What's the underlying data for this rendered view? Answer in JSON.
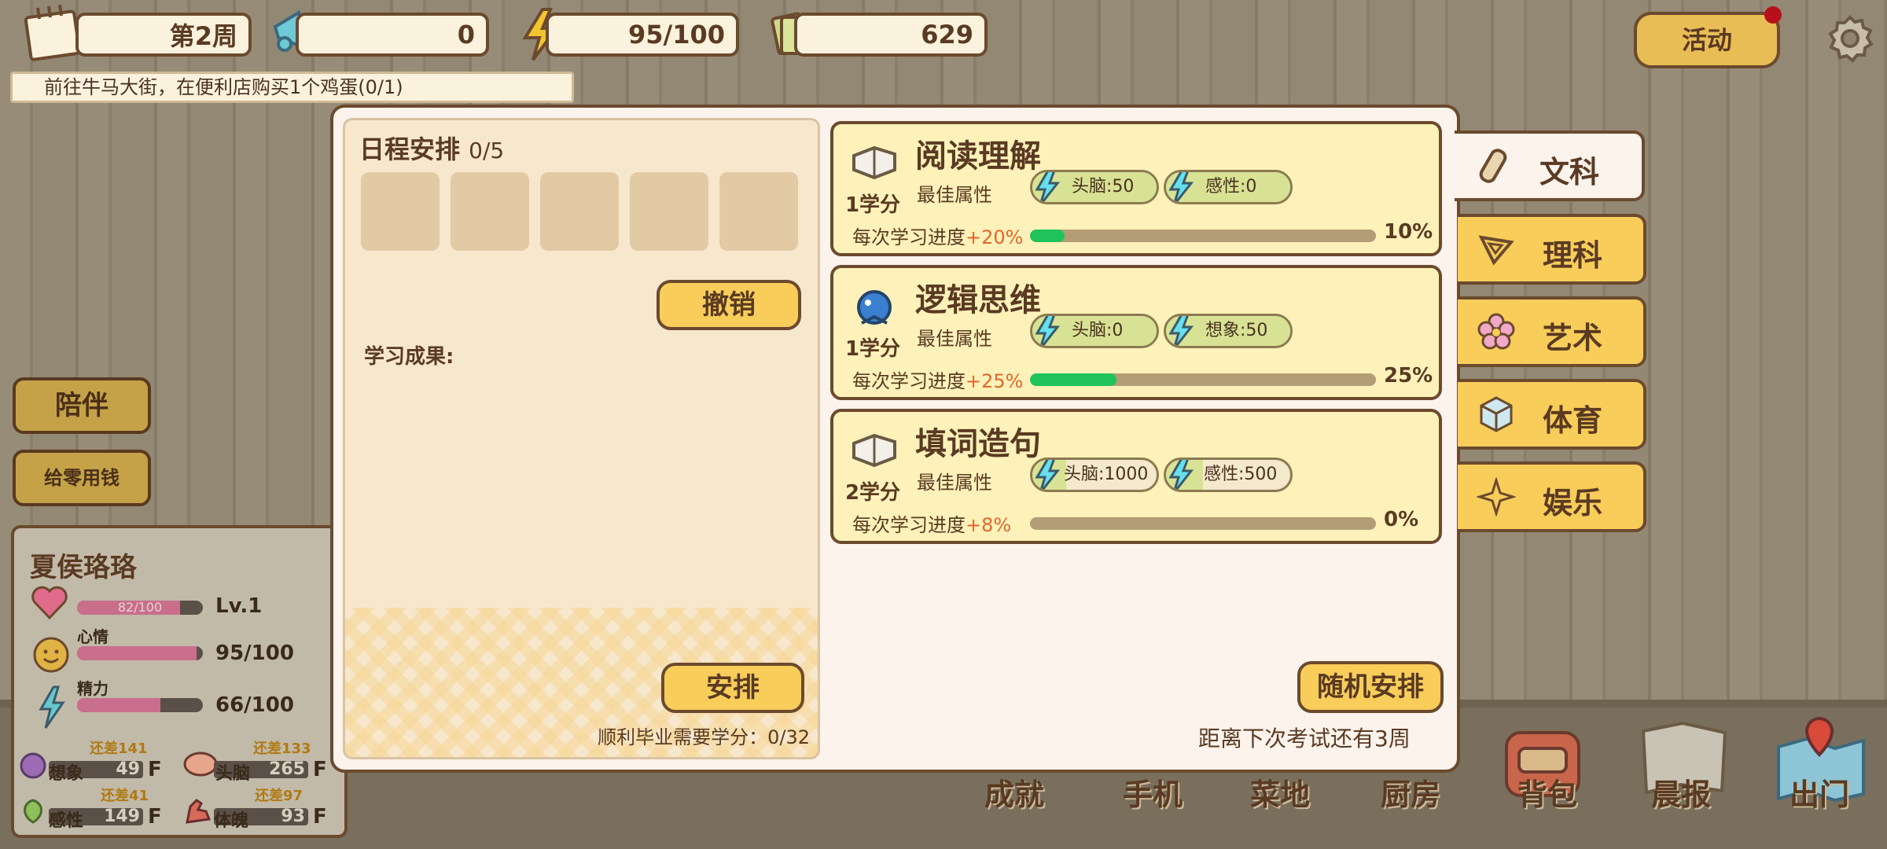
{
  "hud": {
    "week": "第2周",
    "fans": "0",
    "energy": "95/100",
    "money": "629",
    "event_button": "活动"
  },
  "task": "前往牛马大街，在便利店购买1个鸡蛋(0/1)",
  "side_buttons": {
    "accompany": "陪伴",
    "pocket_money": "给零用钱"
  },
  "character": {
    "name": "夏侯珞珞",
    "health_text": "82/100",
    "health_fraction": 0.82,
    "level": "Lv.1",
    "mood_label": "心情",
    "mood_value": "95/100",
    "mood_fraction": 0.95,
    "stamina_label": "精力",
    "stamina_value": "66/100",
    "stamina_fraction": 0.66,
    "attributes": [
      {
        "name": "想象",
        "value": "49",
        "grade": "F",
        "short": "还差141"
      },
      {
        "name": "头脑",
        "value": "265",
        "grade": "F",
        "short": "还差133"
      },
      {
        "name": "感性",
        "value": "149",
        "grade": "F",
        "short": "还差41"
      },
      {
        "name": "体魄",
        "value": "93",
        "grade": "F",
        "short": "还差97"
      }
    ]
  },
  "bottom_nav": [
    "成就",
    "手机",
    "菜地",
    "厨房",
    "背包",
    "晨报",
    "出门"
  ],
  "schedule": {
    "title": "日程安排",
    "count": "0/5",
    "cancel": "撤销",
    "result_label": "学习成果:",
    "arrange": "安排",
    "credit_needed": "顺利毕业需要学分：0/32"
  },
  "courses": [
    {
      "title": "阅读理解",
      "credit": "1学分",
      "best_label": "最佳属性",
      "attr1": "头脑:50",
      "attr1_fill": 1.0,
      "attr2": "感性:0",
      "attr2_fill": 1.0,
      "per_label": "每次学习进度",
      "per_value": "+20%",
      "progress": "10%",
      "progress_fraction": 0.1
    },
    {
      "title": "逻辑思维",
      "credit": "1学分",
      "best_label": "最佳属性",
      "attr1": "头脑:0",
      "attr1_fill": 1.0,
      "attr2": "想象:50",
      "attr2_fill": 1.0,
      "per_label": "每次学习进度",
      "per_value": "+25%",
      "progress": "25%",
      "progress_fraction": 0.25
    },
    {
      "title": "填词造句",
      "credit": "2学分",
      "best_label": "最佳属性",
      "attr1": "头脑:1000",
      "attr1_fill": 0.27,
      "attr2": "感性:500",
      "attr2_fill": 0.3,
      "per_label": "每次学习进度",
      "per_value": "+8%",
      "progress": "0%",
      "progress_fraction": 0.0
    }
  ],
  "random_arrange": "随机安排",
  "exam_notice": "距离下次考试还有3周",
  "tabs": [
    "文科",
    "理科",
    "艺术",
    "体育",
    "娱乐"
  ],
  "colors": {
    "accent_yellow": "#f8cd5a",
    "progress_green": "#1ec45a",
    "highlight_orange": "#e3662a",
    "border_brown": "#6b4a2e"
  }
}
